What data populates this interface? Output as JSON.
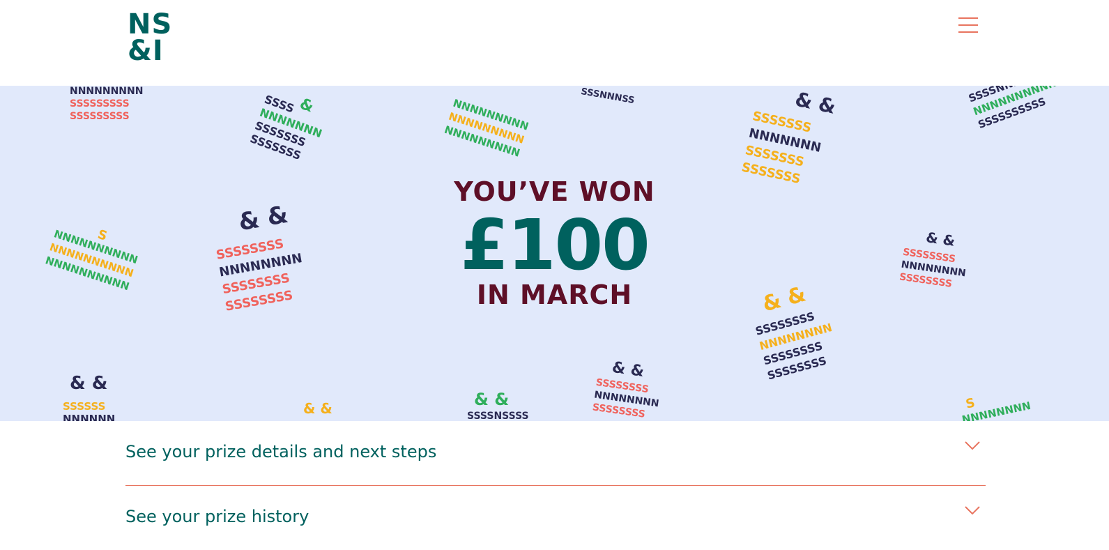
{
  "header": {
    "logo_line1": "NS",
    "logo_line2": "&I",
    "menu_icon": "hamburger-icon"
  },
  "hero": {
    "line1": "YOU’VE WON",
    "amount": "£100",
    "line3": "IN MARCH",
    "background_color": "#e1e9fb",
    "decoration_colors": [
      "#f0625c",
      "#2a2a52",
      "#2fae5b",
      "#f5b01c"
    ]
  },
  "accordion": {
    "items": [
      {
        "title": "See your prize details and next steps",
        "icon": "chevron-down-icon"
      },
      {
        "title": "See your prize history",
        "icon": "chevron-down-icon"
      }
    ]
  },
  "colors": {
    "brand_teal": "#00615e",
    "maroon": "#5e0f27",
    "accent_coral": "#e8745f"
  }
}
